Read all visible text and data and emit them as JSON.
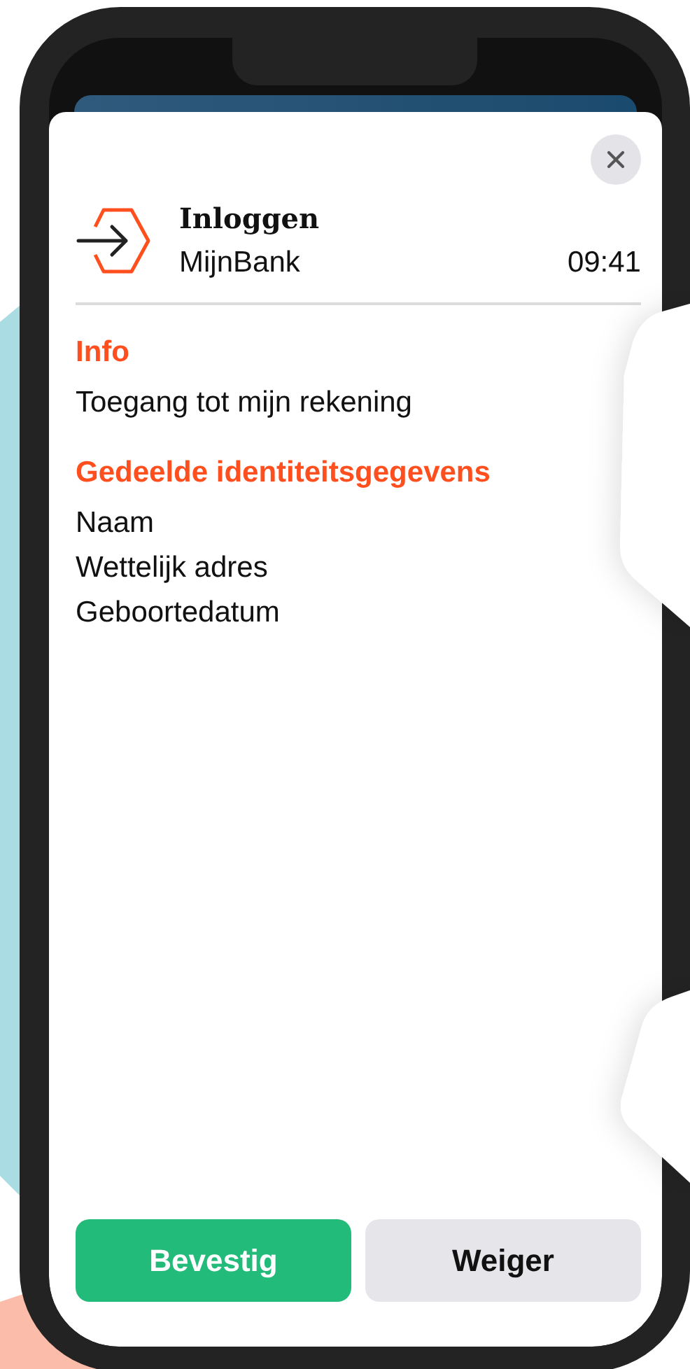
{
  "request": {
    "title": "Inloggen",
    "app": "MijnBank",
    "time": "09:41"
  },
  "sections": [
    {
      "heading": "Info",
      "lines": [
        "Toegang tot mijn rekening"
      ]
    },
    {
      "heading": "Gedeelde identiteitsgegevens",
      "lines": [
        "Naam",
        "Wettelijk adres",
        "Geboortedatum"
      ]
    }
  ],
  "buttons": [
    {
      "label": "Bevestig",
      "kind": "primary"
    },
    {
      "label": "Weiger",
      "kind": "secondary"
    }
  ]
}
